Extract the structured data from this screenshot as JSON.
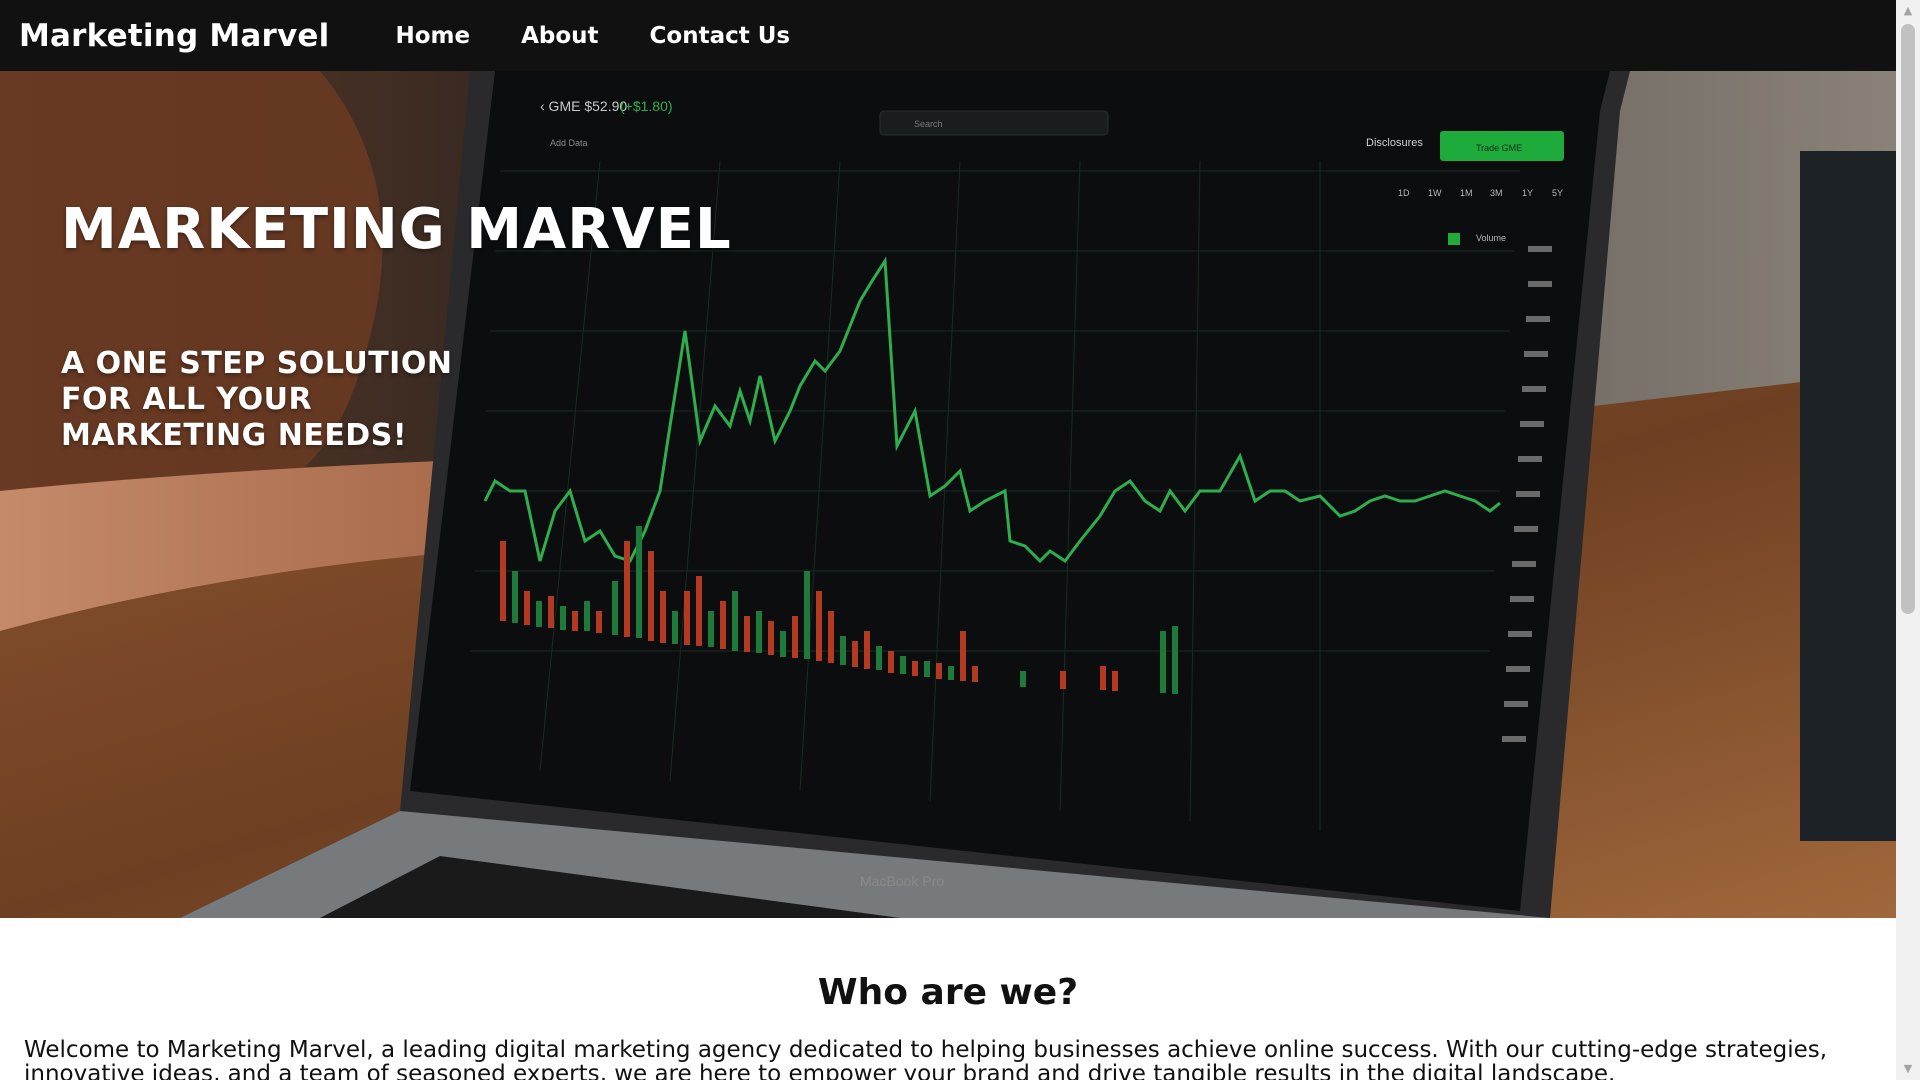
{
  "nav": {
    "brand": "Marketing Marvel",
    "links": [
      {
        "label": "Home"
      },
      {
        "label": "About"
      },
      {
        "label": "Contact Us"
      }
    ]
  },
  "hero": {
    "title": "MARKETING MARVEL",
    "subtitle": "A ONE STEP SOLUTION FOR ALL YOUR MARKETING NEEDS!",
    "image_subject": "laptop showing stock chart",
    "screen": {
      "ticker": "‹ GME $52.90",
      "change": "(+$1.80)",
      "add_data": "Add Data",
      "search_placeholder": "Search",
      "disclosures": "Disclosures",
      "trade_button": "Trade GME",
      "ranges": [
        "1D",
        "1W",
        "1M",
        "3M",
        "1Y",
        "5Y"
      ],
      "volume": "Volume",
      "laptop_label": "MacBook Pro"
    }
  },
  "about": {
    "heading": "Who are we?",
    "text": "Welcome to Marketing Marvel, a leading digital marketing agency dedicated to helping businesses achieve online success. With our cutting-edge strategies, innovative ideas, and a team of seasoned experts, we are here to empower your brand and drive tangible results in the digital landscape."
  },
  "colors": {
    "navbar": "#111111",
    "chart_line": "#2fae4e",
    "trade_button": "#1faa3c"
  }
}
